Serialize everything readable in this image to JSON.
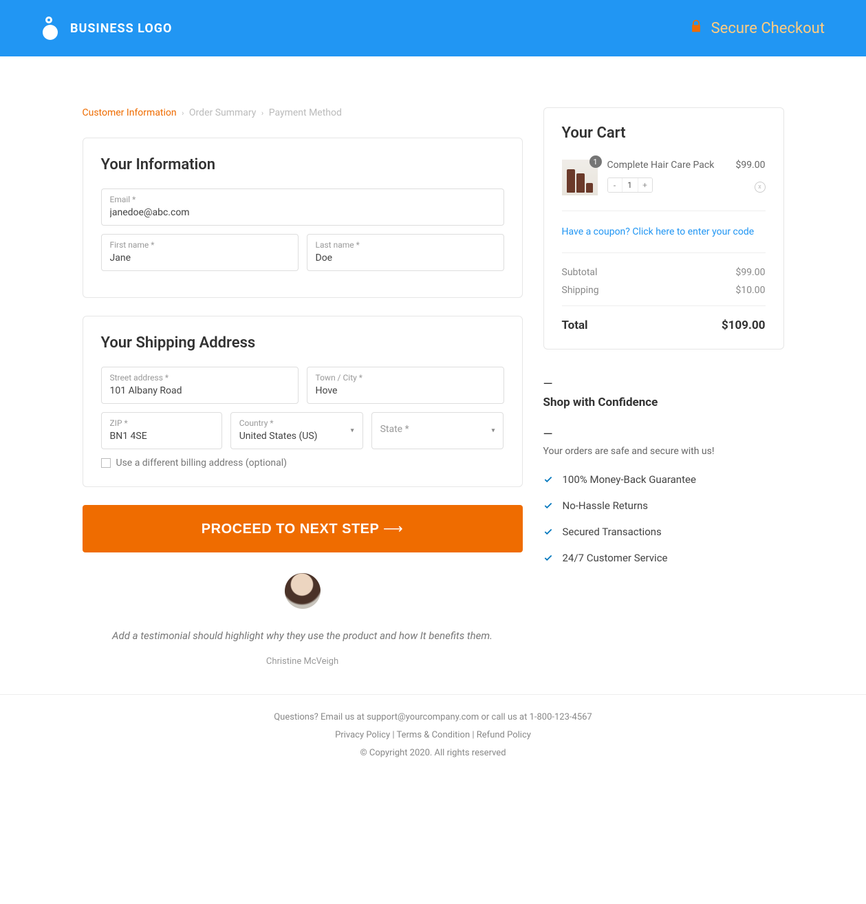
{
  "header": {
    "logo_text": "BUSINESS LOGO",
    "secure_text": "Secure Checkout"
  },
  "breadcrumb": {
    "step1": "Customer Information",
    "step2": "Order Summary",
    "step3": "Payment Method"
  },
  "info": {
    "heading": "Your Information",
    "email_label": "Email *",
    "email_value": "janedoe@abc.com",
    "first_label": "First name *",
    "first_value": "Jane",
    "last_label": "Last name *",
    "last_value": "Doe"
  },
  "shipping": {
    "heading": "Your Shipping Address",
    "street_label": "Street address *",
    "street_value": "101 Albany Road",
    "city_label": "Town / City *",
    "city_value": "Hove",
    "zip_label": "ZIP *",
    "zip_value": "BN1 4SE",
    "country_label": "Country *",
    "country_value": "United States (US)",
    "state_label": "State *",
    "diff_billing": "Use a different billing address (optional)"
  },
  "proceed_label": "PROCEED TO NEXT STEP",
  "testimonial": {
    "quote": "Add a testimonial should highlight why they use the product and how It benefits them.",
    "author": "Christine McVeigh"
  },
  "cart": {
    "heading": "Your Cart",
    "item_name": "Complete Hair Care Pack",
    "item_qty_badge": "1",
    "item_qty_value": "1",
    "item_price": "$99.00",
    "remove_char": "x",
    "coupon_text": "Have a coupon? Click here to enter your code",
    "subtotal_label": "Subtotal",
    "subtotal_value": "$99.00",
    "shipping_label": "Shipping",
    "shipping_value": "$10.00",
    "total_label": "Total",
    "total_value": "$109.00"
  },
  "confidence": {
    "dash": "—",
    "heading": "Shop with Confidence",
    "sub": "Your orders are safe and secure with us!",
    "b1": "100% Money-Back Guarantee",
    "b2": "No-Hassle Returns",
    "b3": "Secured Transactions",
    "b4": "24/7 Customer Service"
  },
  "footer": {
    "contact_pre": "Questions? Email us at ",
    "contact_email": "support@yourcompany.com",
    "contact_mid": " or call us at ",
    "contact_phone": "1-800-123-4567",
    "privacy": "Privacy Policy",
    "terms": "Terms & Condition ",
    "refund": "Refund Policy",
    "sep": " | ",
    "copyright": "© Copyright 2020. All rights reserved"
  }
}
